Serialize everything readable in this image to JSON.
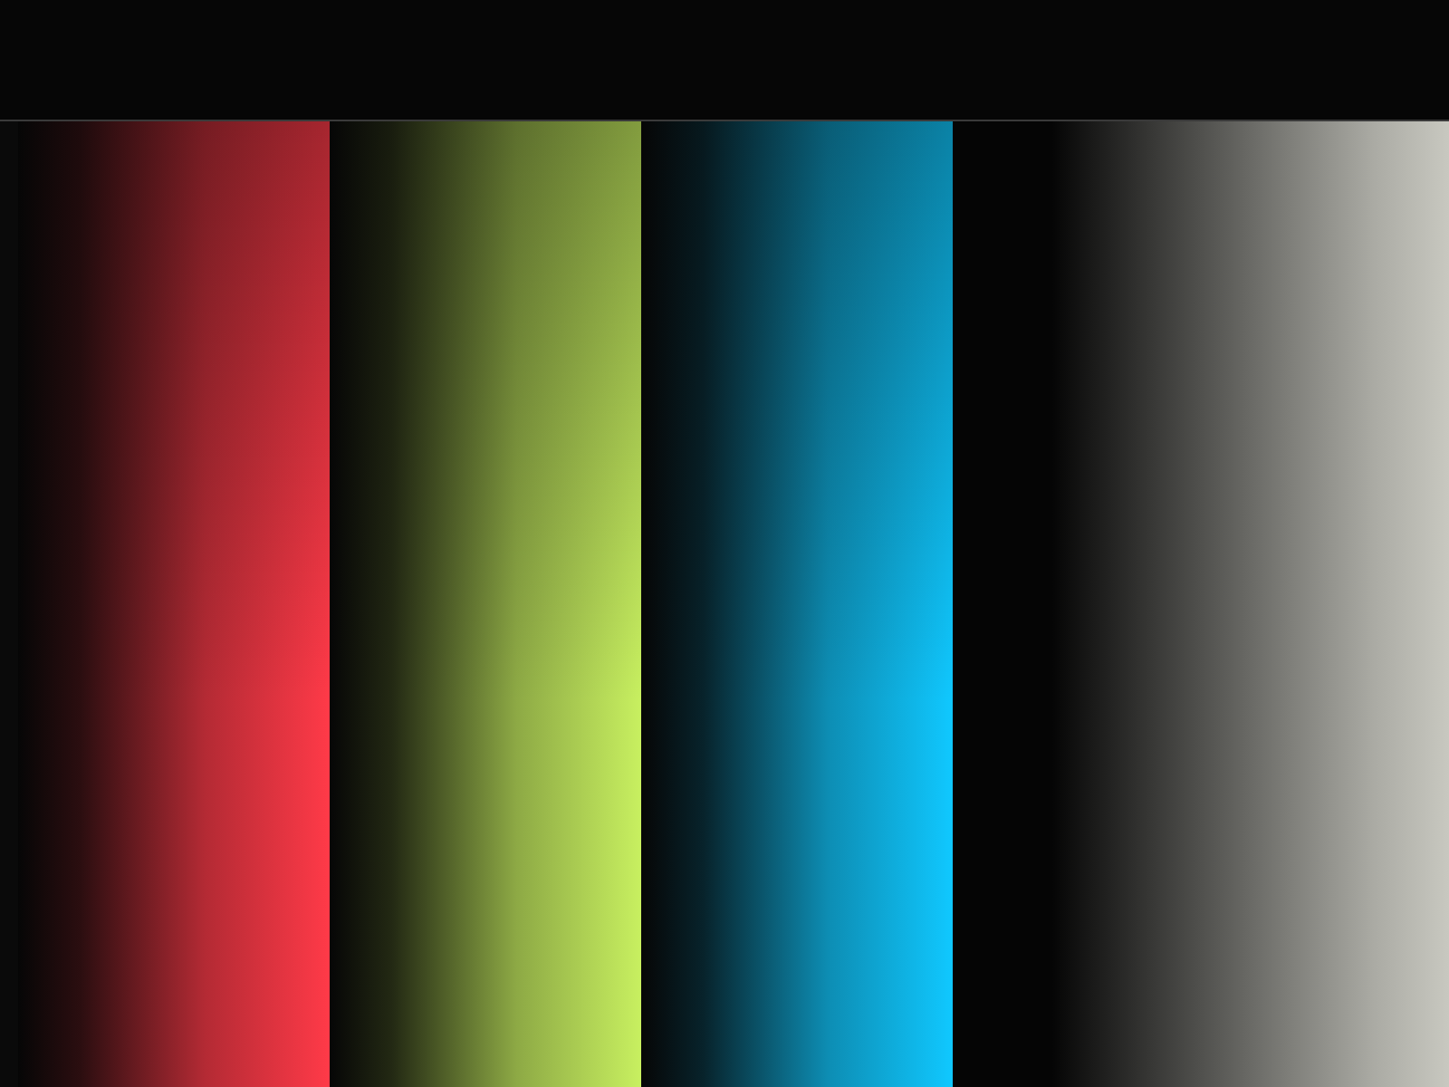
{
  "screen": {
    "bars": [
      {
        "color": "#ff3a48"
      },
      {
        "color": "#c8f060"
      },
      {
        "color": "#10c8ff"
      },
      {
        "color": "#c8c8c0"
      }
    ]
  }
}
